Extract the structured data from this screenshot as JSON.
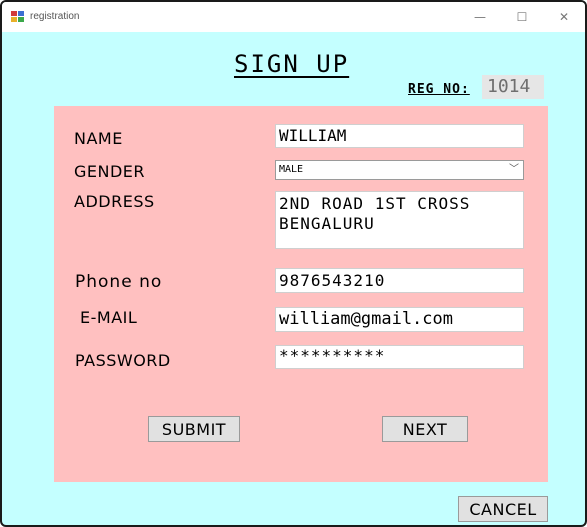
{
  "window": {
    "title": "registration",
    "minimize_glyph": "—",
    "maximize_glyph": "☐",
    "close_glyph": "✕",
    "background_color": "#c4ffff",
    "panel_color": "#ffc0c0"
  },
  "form": {
    "heading": "SIGN UP",
    "reg_no_label": "REG NO:",
    "reg_no_value": "1014",
    "labels": {
      "name": "NAME",
      "gender": "GENDER",
      "address": "ADDRESS",
      "phone": "Phone no",
      "email": "E-MAIL",
      "password": "PASSWORD"
    },
    "values": {
      "name": "WILLIAM",
      "gender": "MALE",
      "address_line1": "2ND ROAD 1ST CROSS",
      "address_line2": "BENGALURU",
      "phone": "9876543210",
      "email": "william@gmail.com",
      "password": "**********"
    },
    "buttons": {
      "submit": "SUBMIT",
      "next": "NEXT",
      "cancel": "CANCEL"
    }
  }
}
